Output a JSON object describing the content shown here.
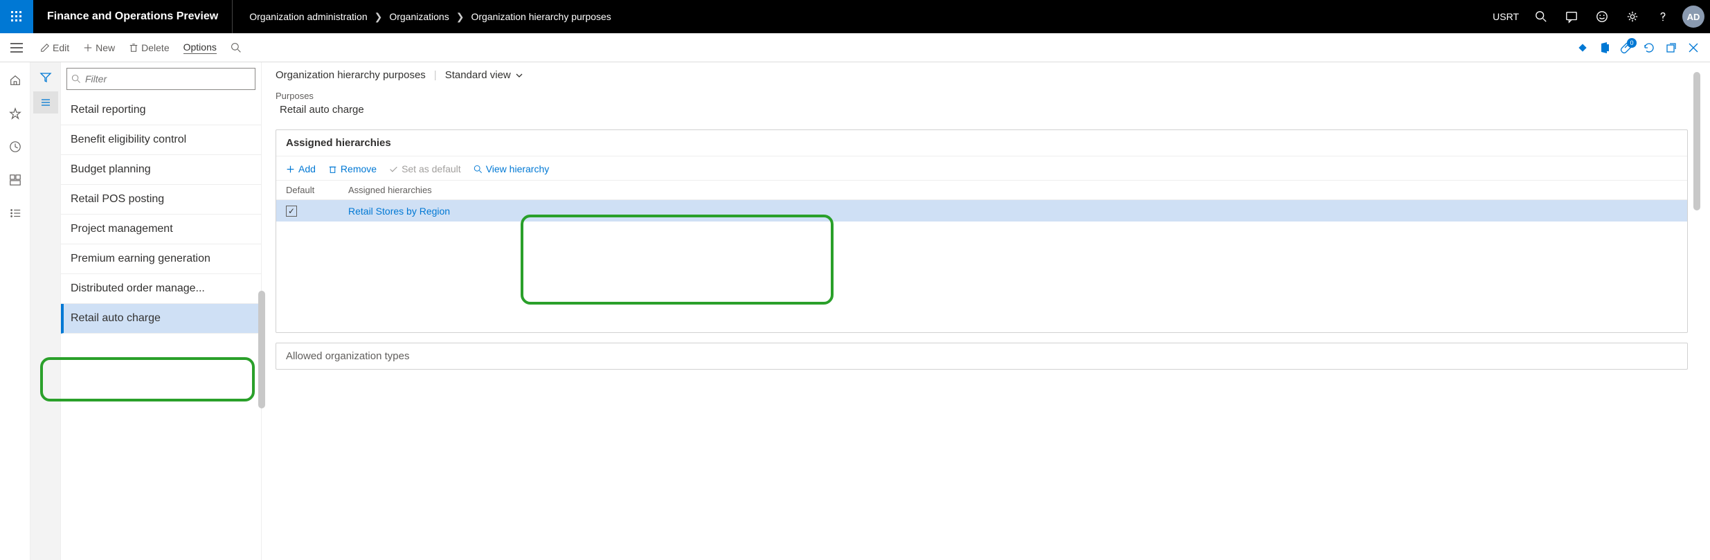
{
  "header": {
    "app_title": "Finance and Operations Preview",
    "breadcrumb": [
      "Organization administration",
      "Organizations",
      "Organization hierarchy purposes"
    ],
    "company": "USRT",
    "avatar_initials": "AD"
  },
  "action_bar": {
    "edit": "Edit",
    "new": "New",
    "delete": "Delete",
    "options": "Options",
    "attachment_badge": "0"
  },
  "list": {
    "filter_placeholder": "Filter",
    "items": [
      "Retail reporting",
      "Benefit eligibility control",
      "Budget planning",
      "Retail POS posting",
      "Project management",
      "Premium earning generation",
      "Distributed order manage...",
      "Retail auto charge"
    ],
    "selected_index": 7
  },
  "main": {
    "page_title": "Organization hierarchy purposes",
    "view_label": "Standard view",
    "purposes_label": "Purposes",
    "purpose_value": "Retail auto charge",
    "section_title": "Assigned hierarchies",
    "toolbar": {
      "add": "Add",
      "remove": "Remove",
      "set_default": "Set as default",
      "view_hierarchy": "View hierarchy"
    },
    "grid": {
      "col_default": "Default",
      "col_hier": "Assigned hierarchies",
      "rows": [
        {
          "default": true,
          "name": "Retail Stores by Region"
        }
      ]
    },
    "section2_title": "Allowed organization types"
  }
}
